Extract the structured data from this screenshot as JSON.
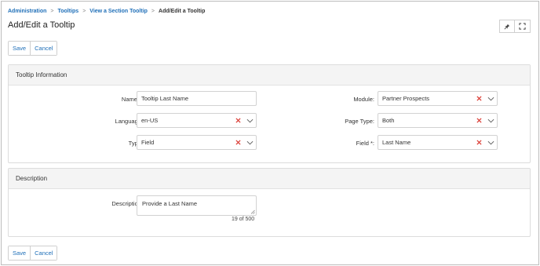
{
  "breadcrumb": [
    "Administration",
    "Tooltips",
    "View a Section Tooltip",
    "Add/Edit a Tooltip"
  ],
  "page_title": "Add/Edit a Tooltip",
  "icons": {
    "pin": "pin-icon",
    "expand": "expand-icon",
    "clear": "clear-x-icon",
    "dropdown": "chevron-down-icon",
    "resize": "resize-handle-icon"
  },
  "actions": {
    "save_label": "Save",
    "cancel_label": "Cancel"
  },
  "tooltip_info": {
    "header": "Tooltip Information",
    "name": {
      "label": "Name *:",
      "value": "Tooltip Last Name"
    },
    "language": {
      "label": "Language:",
      "value": "en-US"
    },
    "type": {
      "label": "Type:",
      "value": "Field"
    },
    "module": {
      "label": "Module:",
      "value": "Partner Prospects"
    },
    "page_type": {
      "label": "Page Type:",
      "value": "Both"
    },
    "field": {
      "label": "Field *:",
      "value": "Last Name"
    }
  },
  "description": {
    "header": "Description",
    "label": "Description:",
    "value": "Provide a Last Name",
    "counter": "19 of 500"
  },
  "colors": {
    "link": "#1f6fb8",
    "clear_icon": "#d9342b",
    "panel_header": "#f4f4f4"
  }
}
